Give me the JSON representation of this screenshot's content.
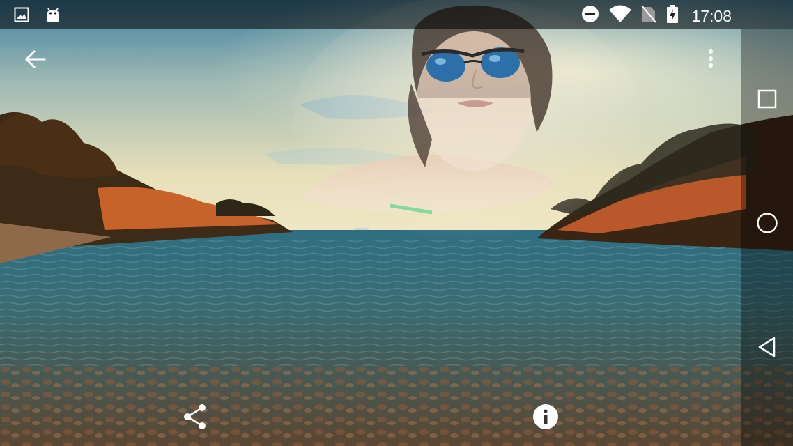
{
  "status_bar": {
    "time": "17:08",
    "left_icons": [
      "image-notification-icon",
      "android-notification-icon"
    ],
    "right_icons": [
      "do-not-disturb-icon",
      "wifi-icon",
      "no-sim-icon",
      "battery-charging-icon"
    ]
  },
  "toolbar": {
    "back_icon": "arrow-back-icon",
    "menu_icon": "more-vert-icon"
  },
  "bottom_actions": {
    "share_icon": "share-icon",
    "info_icon": "info-icon"
  },
  "nav_bar": {
    "icons": [
      "recents-icon",
      "home-icon",
      "back-icon"
    ]
  },
  "colors": {
    "status_bar_bg": "#000000",
    "icon": "#ffffff",
    "sky_top": "#4f8fae",
    "sky_horizon": "#e9e2b8",
    "water": "#3b6f7c",
    "cliff": "#c6622a"
  }
}
